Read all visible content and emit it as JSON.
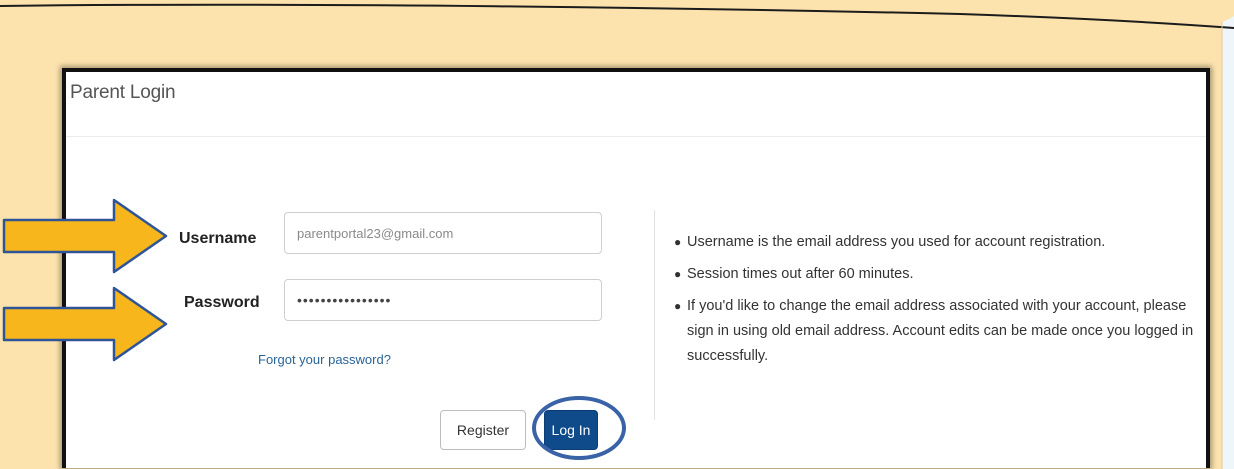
{
  "panel": {
    "title": "Parent Login"
  },
  "form": {
    "username_label": "Username",
    "username_value": "parentportal23@gmail.com",
    "password_label": "Password",
    "password_value": "••••••••••••••••",
    "forgot_link": "Forgot your password?",
    "register_label": "Register",
    "login_label": "Log In"
  },
  "info": {
    "items": [
      "Username is the email address you used for account registration.",
      "Session times out after 60 minutes.",
      "If you'd like to change the email address associated with your account, please sign in using old email address. Account edits can be made once you logged in successfully."
    ]
  },
  "colors": {
    "paper": "#fce3ae",
    "arrow_fill": "#f6b61c",
    "arrow_outline": "#2f5597",
    "login_button": "#0f4a8a",
    "highlight_ring": "#3a62a6"
  },
  "annotations": {
    "arrows": [
      "pointing-arrow-username",
      "pointing-arrow-password"
    ],
    "highlight": "log-in-button-ring"
  }
}
